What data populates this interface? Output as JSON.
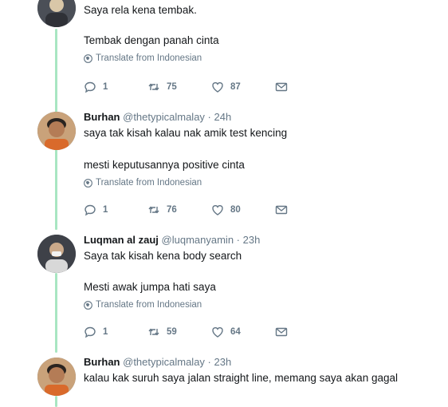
{
  "tweets": [
    {
      "name": "",
      "handle": "",
      "time": "",
      "lines": [
        "Saya rela kena tembak.",
        "Tembak dengan panah cinta"
      ],
      "translate": "Translate from Indonesian",
      "replies": "1",
      "retweets": "75",
      "likes": "87"
    },
    {
      "name": "Burhan",
      "handle": "@thetypicalmalay",
      "sep": "·",
      "time": "24h",
      "lines": [
        "saya tak kisah kalau nak amik test kencing",
        "mesti keputusannya positive cinta"
      ],
      "translate": "Translate from Indonesian",
      "replies": "1",
      "retweets": "76",
      "likes": "80"
    },
    {
      "name": "Luqman al zauj",
      "handle": "@luqmanyamin",
      "sep": "·",
      "time": "23h",
      "lines": [
        "Saya tak kisah kena body search",
        "Mesti awak jumpa hati saya"
      ],
      "translate": "Translate from Indonesian",
      "replies": "1",
      "retweets": "59",
      "likes": "64"
    },
    {
      "name": "Burhan",
      "handle": "@thetypicalmalay",
      "sep": "·",
      "time": "23h",
      "lines": [
        "kalau kak suruh saya jalan straight line, memang saya akan gagal"
      ]
    }
  ],
  "colors": {
    "thread": "#a8e6c2",
    "meta": "#657786",
    "text": "#14171a"
  }
}
